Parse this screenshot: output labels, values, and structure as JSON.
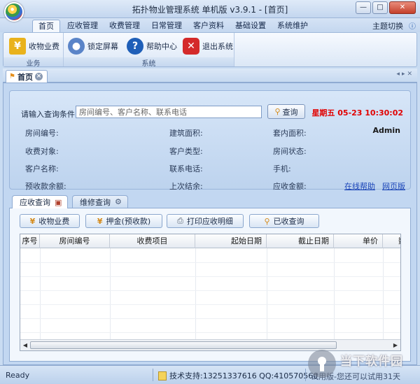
{
  "window": {
    "title": "拓扑物业管理系统 单机版 v3.9.1 - [首页]"
  },
  "menu": {
    "tabs": [
      "首页",
      "应收管理",
      "收费管理",
      "日常管理",
      "客户资料",
      "基础设置",
      "系统维护"
    ],
    "right": "主题切换"
  },
  "ribbon": {
    "groups": [
      {
        "label": "业务",
        "buttons": [
          "收物业费"
        ]
      },
      {
        "label": "系统",
        "buttons": [
          "锁定屏幕",
          "帮助中心",
          "退出系统"
        ]
      }
    ]
  },
  "doc_tab": {
    "label": "首页"
  },
  "query": {
    "label": "请输入查询条件",
    "placeholder": "房间编号、客户名称、联系电话",
    "button": "查询"
  },
  "clock": "星期五 05-23 10:30:02",
  "user": "Admin",
  "fields": {
    "room_no": "房间编号:",
    "build_area": "建筑面积:",
    "inner_area": "套内面积:",
    "charge_target": "收费对象:",
    "customer_type": "客户类型:",
    "room_status": "房间状态:",
    "customer_name": "客户名称:",
    "phone": "联系电话:",
    "mobile": "手机:",
    "prepay_balance": "预收款余额:",
    "last_balance": "上次结余:",
    "receivable": "应收金额:"
  },
  "links": {
    "online_help": "在线帮助",
    "web_version": "网页版"
  },
  "tabs": {
    "receivable_query": "应收查询",
    "repair_query": "维修查询"
  },
  "toolbar": {
    "collect_fee": "收物业费",
    "deposit": "押金(预收款)",
    "print_detail": "打印应收明细",
    "collected_query": "已收查询"
  },
  "grid": {
    "columns": [
      "序号",
      "房间编号",
      "收费项目",
      "起始日期",
      "截止日期",
      "单价",
      "数"
    ]
  },
  "status": {
    "ready": "Ready",
    "support": "技术支持:13251337616 QQ:410570560",
    "trial": "试用版-您还可以试用31天"
  },
  "watermark": "当下软件园",
  "colors": {
    "clock": "#e10000",
    "link": "#1a44b8",
    "accent": "#3b6fd1"
  }
}
